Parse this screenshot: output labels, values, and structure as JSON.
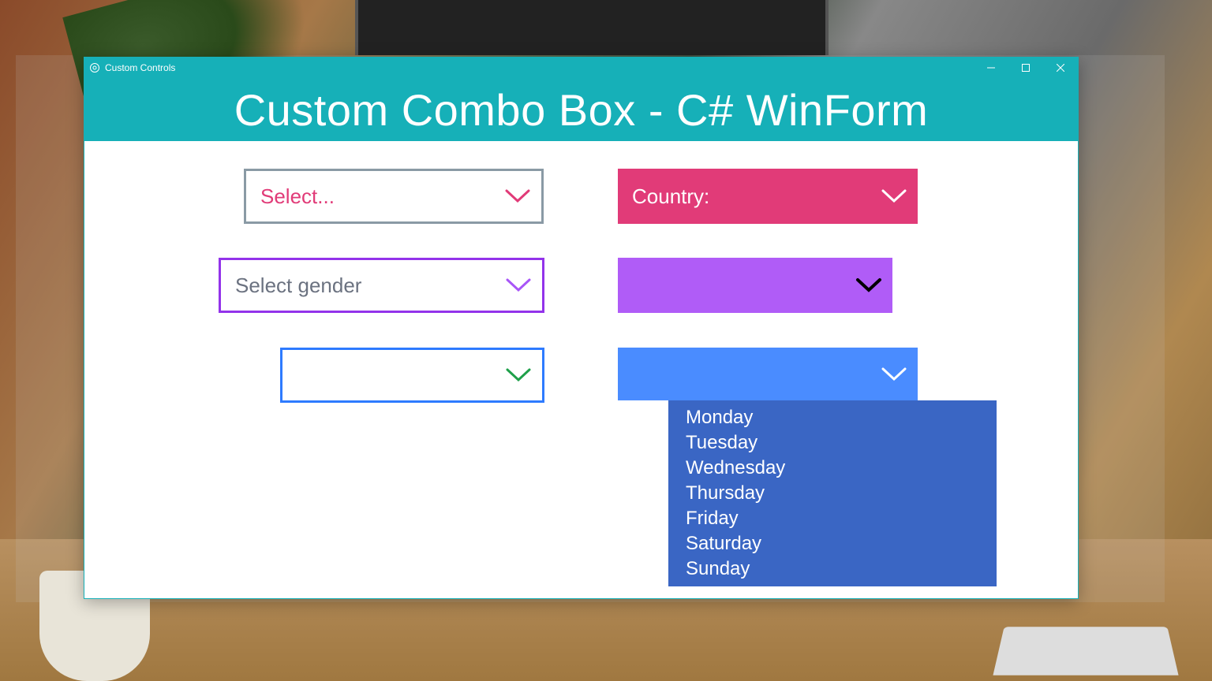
{
  "window": {
    "title": "Custom Controls",
    "header": "Custom Combo Box - C# WinForm"
  },
  "combos": {
    "select": {
      "label": "Select..."
    },
    "country": {
      "label": "Country:"
    },
    "gender": {
      "label": "Select gender"
    },
    "purple": {
      "label": ""
    },
    "blue_outline": {
      "label": ""
    },
    "days": {
      "label": ""
    }
  },
  "dropdown_items": [
    "Monday",
    "Tuesday",
    "Wednesday",
    "Thursday",
    "Friday",
    "Saturday",
    "Sunday"
  ]
}
